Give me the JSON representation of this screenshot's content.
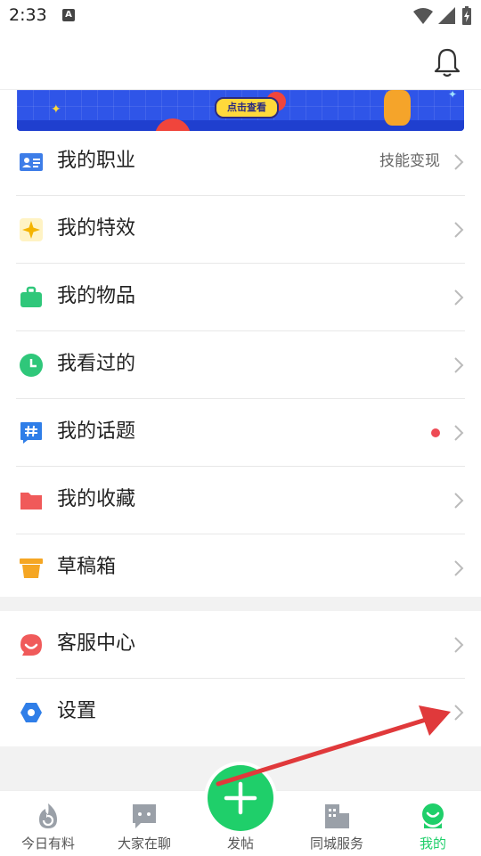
{
  "status_bar": {
    "time": "2:33",
    "notice_badge": "A"
  },
  "header": {
    "bell_icon": "bell-icon"
  },
  "banner": {
    "button_text": "点击查看"
  },
  "menu_items": [
    {
      "label": "我的职业",
      "extra": "技能变现",
      "icon": "id-card-icon",
      "color": "#3d7de8"
    },
    {
      "label": "我的特效",
      "extra": "",
      "icon": "sparkle-icon",
      "color": "#f5b400"
    },
    {
      "label": "我的物品",
      "extra": "",
      "icon": "bag-icon",
      "color": "#2fc77a"
    },
    {
      "label": "我看过的",
      "extra": "",
      "icon": "clock-icon",
      "color": "#2fc77a"
    },
    {
      "label": "我的话题",
      "extra": "",
      "icon": "hashtag-icon",
      "color": "#2f7ee8",
      "has_dot": true
    },
    {
      "label": "我的收藏",
      "extra": "",
      "icon": "folder-icon",
      "color": "#f05a5a"
    },
    {
      "label": "草稿箱",
      "extra": "",
      "icon": "box-icon",
      "color": "#f5a623"
    }
  ],
  "service_items": [
    {
      "label": "客服中心",
      "icon": "support-icon",
      "color": "#f05a5a"
    },
    {
      "label": "设置",
      "icon": "settings-icon",
      "color": "#2f7ee8"
    }
  ],
  "tabs": [
    {
      "label": "今日有料",
      "icon": "flame-refresh-icon"
    },
    {
      "label": "大家在聊",
      "icon": "chat-icon"
    },
    {
      "label": "发帖",
      "icon": "plus-icon"
    },
    {
      "label": "同城服务",
      "icon": "buildings-icon"
    },
    {
      "label": "我的",
      "icon": "profile-icon",
      "active": true
    }
  ],
  "colors": {
    "accent_green": "#1fcf6a",
    "annotation_red": "#e0393b"
  }
}
